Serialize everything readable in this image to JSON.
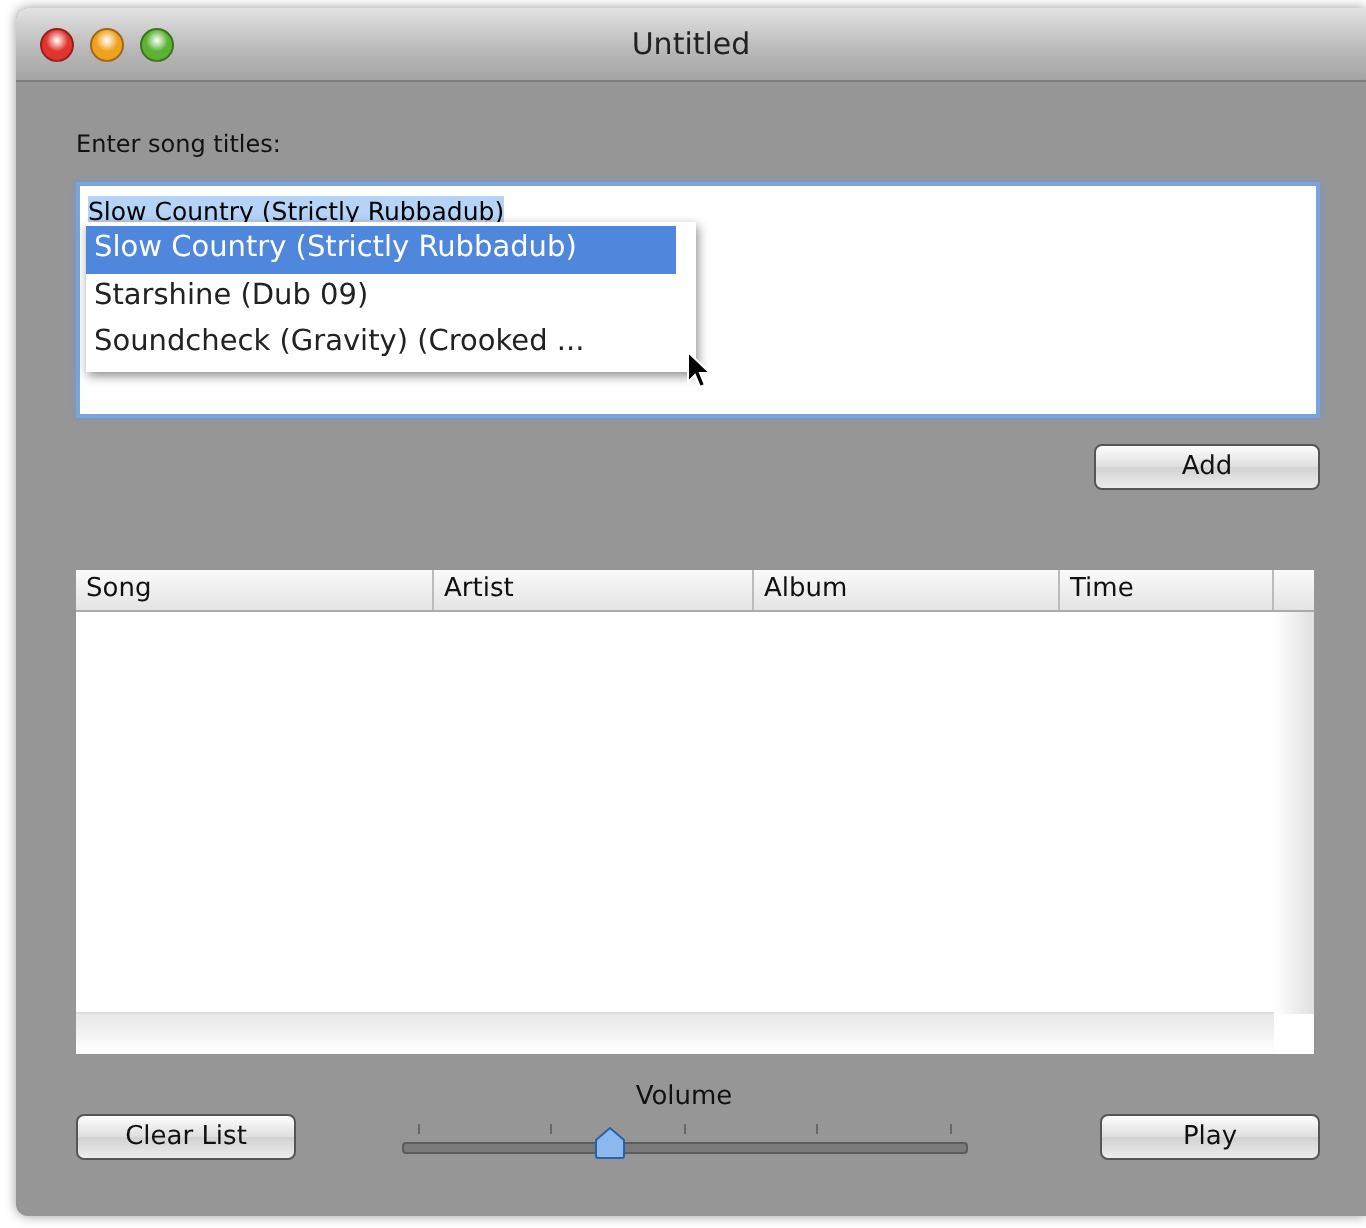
{
  "window": {
    "title": "Untitled"
  },
  "song_input": {
    "label": "Enter song titles:",
    "value": "Slow Country (Strictly Rubbadub)",
    "value_selected": true,
    "completions": [
      {
        "label": "Slow Country (Strictly Rubbadub)",
        "selected": true
      },
      {
        "label": "Starshine (Dub 09)",
        "selected": false
      },
      {
        "label": "Soundcheck (Gravity) (Crooked ...",
        "selected": false
      }
    ]
  },
  "add_button": "Add",
  "table": {
    "columns": [
      "Song",
      "Artist",
      "Album",
      "Time"
    ]
  },
  "volume": {
    "label": "Volume",
    "level": 0.36
  },
  "buttons": {
    "clear": "Clear List",
    "play": "Play"
  }
}
